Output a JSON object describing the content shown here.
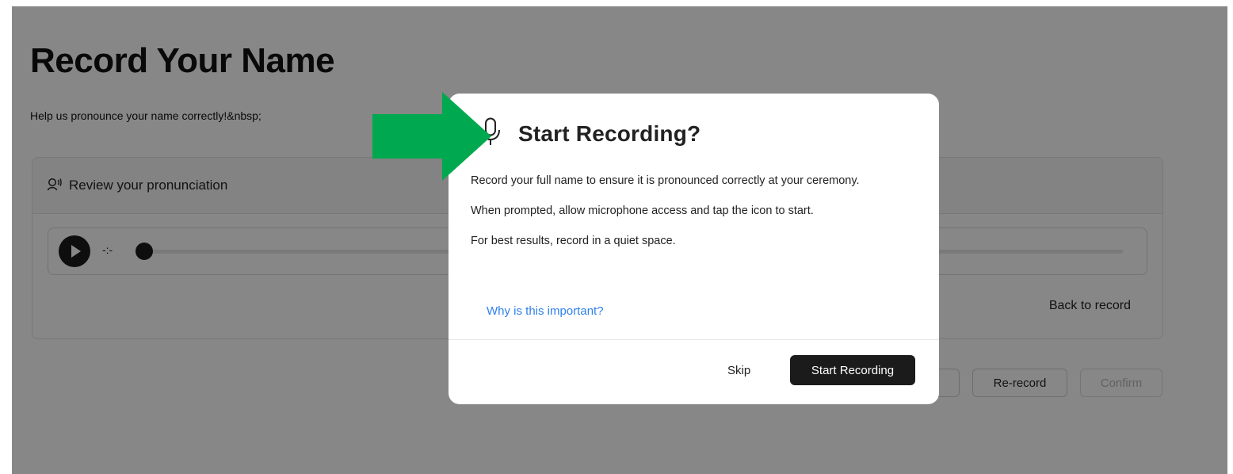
{
  "page": {
    "title": "Record Your Name",
    "subtitle": "Help us pronounce your name correctly!&nbsp;"
  },
  "review": {
    "header_label": "Review your pronunciation",
    "header_icon": "speaking-person-icon",
    "player": {
      "time": "-:-",
      "play_icon": "play-icon",
      "progress": 0
    },
    "back_link": "Back to record"
  },
  "actions": {
    "previous_label": "‹",
    "rerecord_label": "Re-record",
    "confirm_label": "Confirm"
  },
  "modal": {
    "icon": "microphone-icon",
    "title": "Start Recording?",
    "paragraphs": [
      "Record your full name to ensure it is pronounced correctly at your ceremony.",
      "When prompted, allow microphone access and tap the icon to start.",
      "For best results, record in a quiet space."
    ],
    "link": "Why is this important?",
    "skip_label": "Skip",
    "start_label": "Start Recording"
  },
  "annotation": {
    "arrow_color": "#00a94f"
  },
  "colors": {
    "link": "#2f80ed",
    "primary_button": "#1b1b1b",
    "overlay": "rgba(0,0,0,0.47)"
  }
}
